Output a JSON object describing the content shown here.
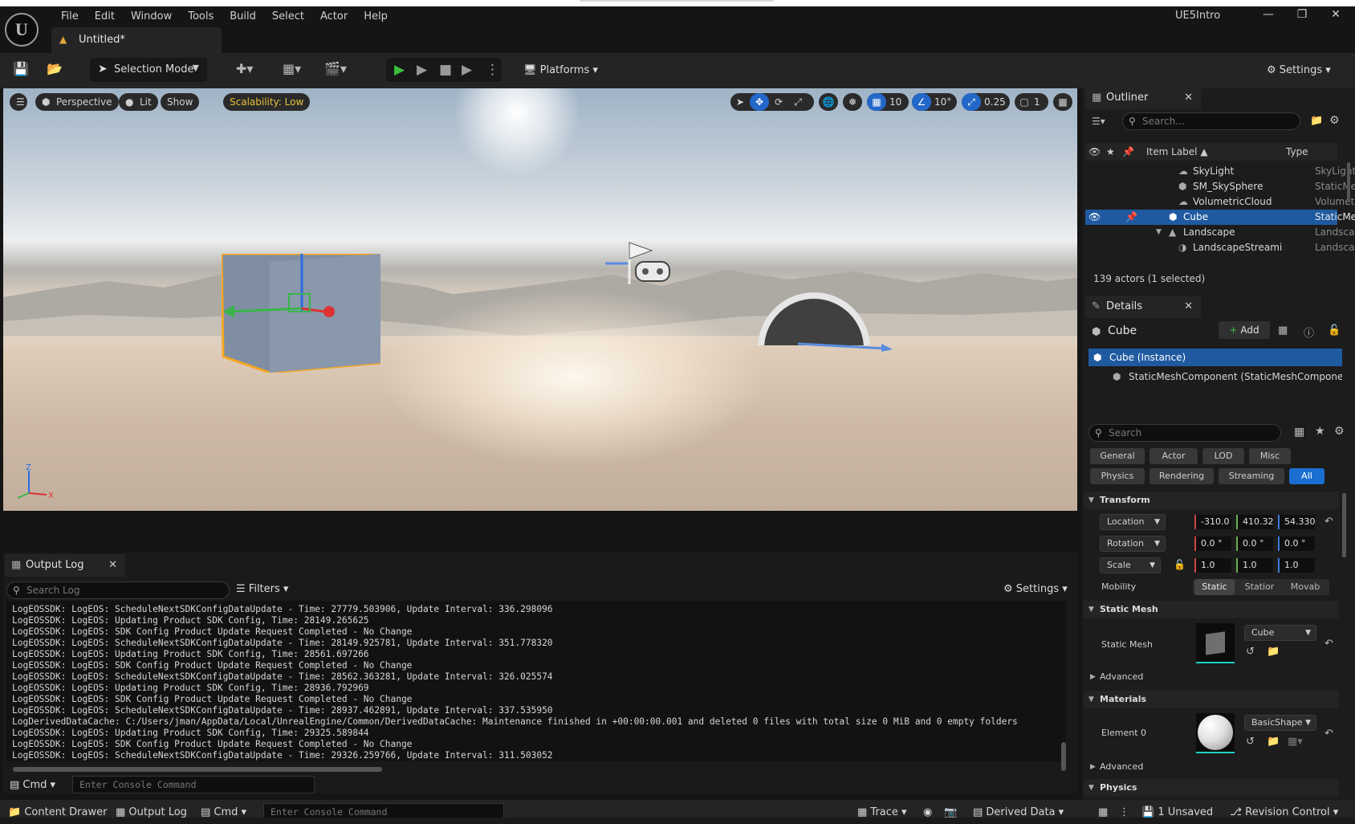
{
  "menu": [
    "File",
    "Edit",
    "Window",
    "Tools",
    "Build",
    "Select",
    "Actor",
    "Help"
  ],
  "project_name": "UE5Intro",
  "document_tab": "Untitled*",
  "toolbar": {
    "selection_mode": "Selection Mode",
    "platforms": "Platforms",
    "settings": "Settings"
  },
  "viewport": {
    "perspective": "Perspective",
    "lit": "Lit",
    "show": "Show",
    "scalability": "Scalability: Low",
    "grid_snap": "10",
    "rot_snap": "10°",
    "scale_snap": "0.25",
    "camera_speed": "1",
    "axis": {
      "z": "Z",
      "x": "X"
    }
  },
  "outliner": {
    "title": "Outliner",
    "search_placeholder": "Search...",
    "col_label": "Item Label ▲",
    "col_type": "Type",
    "rows": [
      {
        "label": "SkyLight",
        "type": "SkyLight"
      },
      {
        "label": "SM_SkySphere",
        "type": "StaticMesh"
      },
      {
        "label": "VolumetricCloud",
        "type": "Volumetric"
      },
      {
        "label": "Cube",
        "type": "StaticMesh",
        "selected": true
      },
      {
        "label": "Landscape",
        "type": "Landscape"
      },
      {
        "label": "LandscapeStreami",
        "type": "Landscape"
      }
    ],
    "count": "139 actors (1 selected)"
  },
  "details": {
    "title": "Details",
    "actor": "Cube",
    "add": "Add",
    "components": [
      "Cube (Instance)",
      "StaticMeshComponent (StaticMeshComponent"
    ],
    "search_placeholder": "Search",
    "categories_row1": [
      "General",
      "Actor",
      "LOD",
      "Misc"
    ],
    "categories_row2": [
      "Physics",
      "Rendering",
      "Streaming",
      "All"
    ],
    "transform": {
      "section": "Transform",
      "location_label": "Location",
      "location": [
        "-310.0",
        "410.32",
        "54.330"
      ],
      "rotation_label": "Rotation",
      "rotation": [
        "0.0 °",
        "0.0 °",
        "0.0 °"
      ],
      "scale_label": "Scale",
      "scale": [
        "1.0",
        "1.0",
        "1.0"
      ],
      "mobility_label": "Mobility",
      "mobility": [
        "Static",
        "Statior",
        "Movab"
      ]
    },
    "static_mesh": {
      "section": "Static Mesh",
      "label": "Static Mesh",
      "value": "Cube",
      "advanced": "Advanced"
    },
    "materials": {
      "section": "Materials",
      "label": "Element 0",
      "value": "BasicShape",
      "advanced": "Advanced"
    },
    "physics": {
      "section": "Physics"
    }
  },
  "output_log": {
    "title": "Output Log",
    "search_placeholder": "Search Log",
    "filters": "Filters",
    "settings": "Settings",
    "lines": [
      "LogEOSSDK: LogEOS: ScheduleNextSDKConfigDataUpdate - Time: 27779.503906, Update Interval: 336.298096",
      "LogEOSSDK: LogEOS: Updating Product SDK Config, Time: 28149.265625",
      "LogEOSSDK: LogEOS: SDK Config Product Update Request Completed - No Change",
      "LogEOSSDK: LogEOS: ScheduleNextSDKConfigDataUpdate - Time: 28149.925781, Update Interval: 351.778320",
      "LogEOSSDK: LogEOS: Updating Product SDK Config, Time: 28561.697266",
      "LogEOSSDK: LogEOS: SDK Config Product Update Request Completed - No Change",
      "LogEOSSDK: LogEOS: ScheduleNextSDKConfigDataUpdate - Time: 28562.363281, Update Interval: 326.025574",
      "LogEOSSDK: LogEOS: Updating Product SDK Config, Time: 28936.792969",
      "LogEOSSDK: LogEOS: SDK Config Product Update Request Completed - No Change",
      "LogEOSSDK: LogEOS: ScheduleNextSDKConfigDataUpdate - Time: 28937.462891, Update Interval: 337.535950",
      "LogDerivedDataCache: C:/Users/jman/AppData/Local/UnrealEngine/Common/DerivedDataCache: Maintenance finished in +00:00:00.001 and deleted 0 files with total size 0 MiB and 0 empty folders",
      "LogEOSSDK: LogEOS: Updating Product SDK Config, Time: 29325.589844",
      "LogEOSSDK: LogEOS: SDK Config Product Update Request Completed - No Change",
      "LogEOSSDK: LogEOS: ScheduleNextSDKConfigDataUpdate - Time: 29326.259766, Update Interval: 311.503052"
    ],
    "cmd_label": "Cmd",
    "cmd_placeholder": "Enter Console Command"
  },
  "statusbar": {
    "content_drawer": "Content Drawer",
    "output_log": "Output Log",
    "cmd": "Cmd",
    "cmd_placeholder": "Enter Console Command",
    "trace": "Trace",
    "derived_data": "Derived Data",
    "unsaved": "1 Unsaved",
    "revision_control": "Revision Control"
  },
  "colors": {
    "accent": "#1f5aa0",
    "scalability": "#e8c23a",
    "play": "#3bbf3b"
  }
}
